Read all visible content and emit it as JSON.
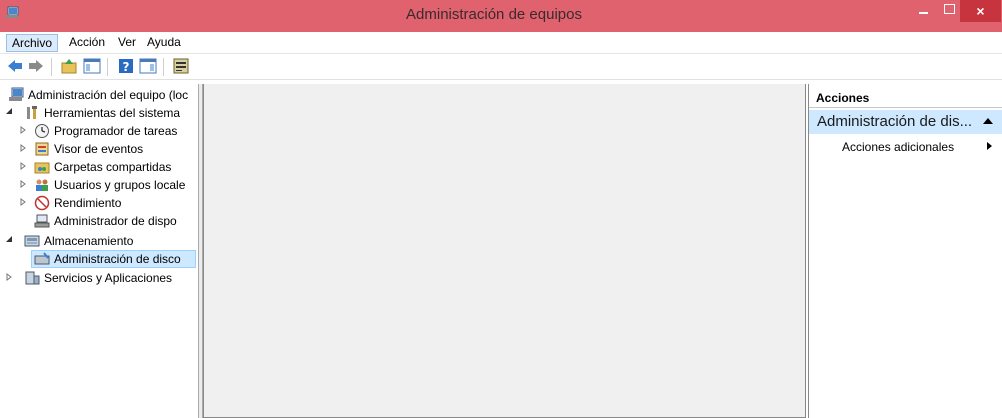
{
  "window": {
    "title": "Administración de equipos",
    "close_glyph": "×"
  },
  "menu": [
    {
      "label": "Archivo"
    },
    {
      "label": "Acción"
    },
    {
      "label": "Ver"
    },
    {
      "label": "Ayuda"
    }
  ],
  "toolbar": {
    "icons": [
      "back-arrow-icon",
      "forward-arrow-icon",
      "up-folder-icon",
      "show-hide-console-tree-icon",
      "help-icon",
      "show-hide-action-pane-icon",
      "properties-icon"
    ]
  },
  "tree": {
    "root": "Administración del equipo (loc",
    "system_tools": "Herramientas del sistema",
    "task_scheduler": "Programador de tareas",
    "event_viewer": "Visor de eventos",
    "shared_folders": "Carpetas compartidas",
    "local_users": "Usuarios y grupos locale",
    "performance": "Rendimiento",
    "device_manager": "Administrador de dispo",
    "storage": "Almacenamiento",
    "disk_management": "Administración de disco",
    "services_apps": "Servicios y Aplicaciones"
  },
  "actions": {
    "header": "Acciones",
    "section": "Administración de dis...",
    "more_actions": "Acciones adicionales"
  },
  "colors": {
    "titlebar": "#e0626e",
    "close_button": "#c7343d",
    "selection": "#cde8ff",
    "center_background": "#f0f0f0"
  }
}
